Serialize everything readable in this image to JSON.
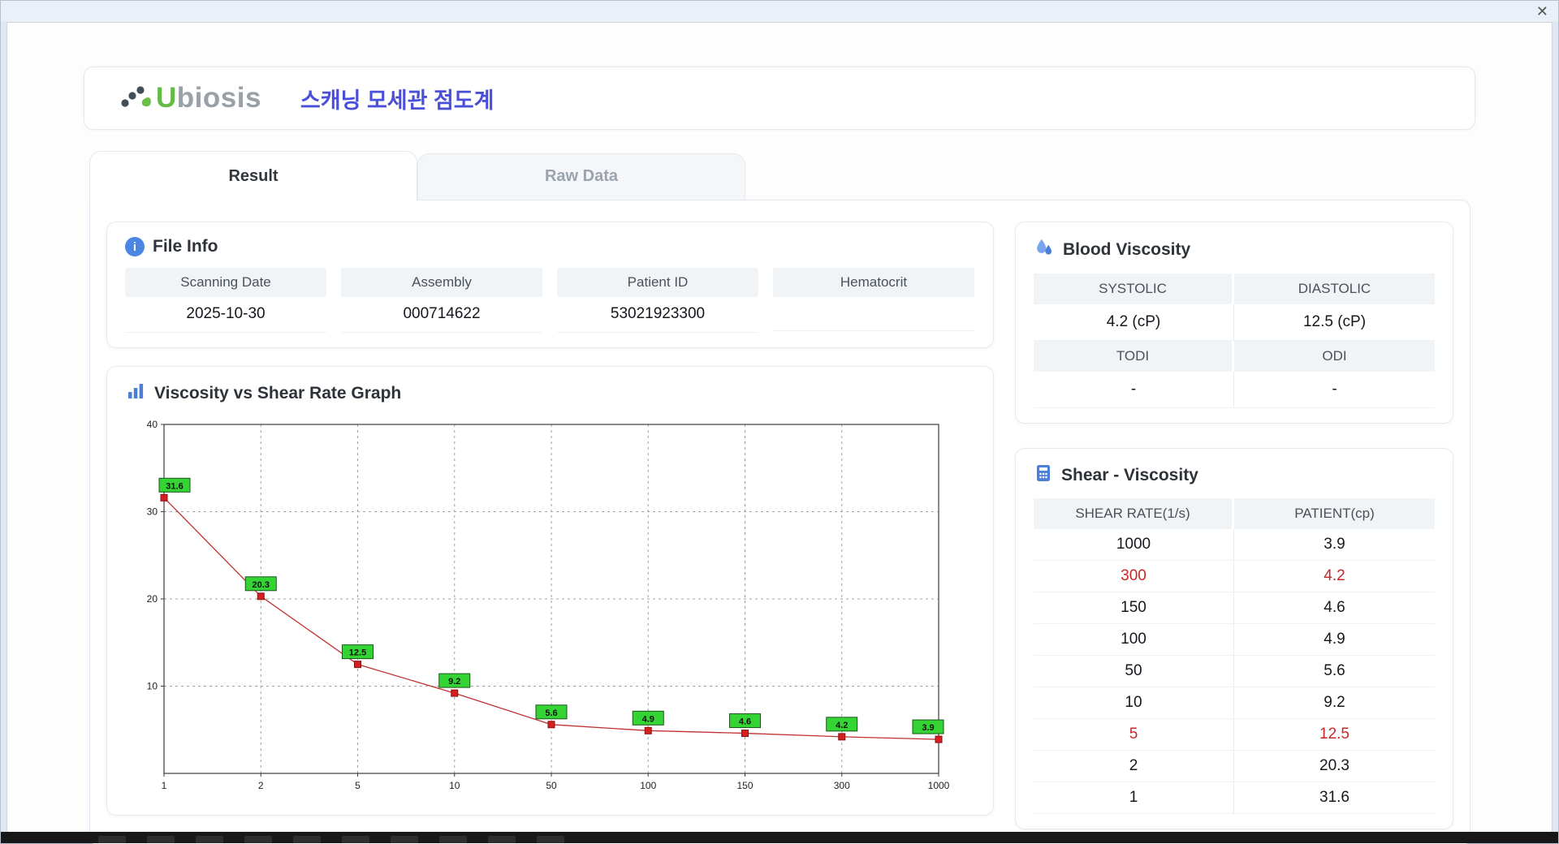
{
  "window": {
    "close_label": "✕"
  },
  "header": {
    "logo_u": "U",
    "logo_rest": "biosis",
    "app_title": "스캐닝 모세관 점도계"
  },
  "tabs": [
    {
      "label": "Result",
      "active": true
    },
    {
      "label": "Raw Data",
      "active": false
    }
  ],
  "file_info": {
    "title": "File Info",
    "info_icon_glyph": "i",
    "fields": [
      {
        "label": "Scanning Date",
        "value": "2025-10-30"
      },
      {
        "label": "Assembly",
        "value": "000714622"
      },
      {
        "label": "Patient ID",
        "value": "53021923300"
      },
      {
        "label": "Hematocrit",
        "value": ""
      }
    ]
  },
  "blood_viscosity": {
    "title": "Blood Viscosity",
    "metrics": [
      {
        "label": "SYSTOLIC",
        "value": "4.2 (cP)"
      },
      {
        "label": "DIASTOLIC",
        "value": "12.5 (cP)"
      },
      {
        "label": "TODI",
        "value": "-"
      },
      {
        "label": "ODI",
        "value": "-"
      }
    ]
  },
  "shear_viscosity": {
    "title": "Shear - Viscosity",
    "columns": [
      "SHEAR RATE(1/s)",
      "PATIENT(cp)"
    ],
    "rows": [
      {
        "shear_rate": "1000",
        "patient": "3.9",
        "highlight": false
      },
      {
        "shear_rate": "300",
        "patient": "4.2",
        "highlight": true
      },
      {
        "shear_rate": "150",
        "patient": "4.6",
        "highlight": false
      },
      {
        "shear_rate": "100",
        "patient": "4.9",
        "highlight": false
      },
      {
        "shear_rate": "50",
        "patient": "5.6",
        "highlight": false
      },
      {
        "shear_rate": "10",
        "patient": "9.2",
        "highlight": false
      },
      {
        "shear_rate": "5",
        "patient": "12.5",
        "highlight": true
      },
      {
        "shear_rate": "2",
        "patient": "20.3",
        "highlight": false
      },
      {
        "shear_rate": "1",
        "patient": "31.6",
        "highlight": false
      }
    ]
  },
  "graph": {
    "title": "Viscosity vs Shear Rate Graph"
  },
  "chart_data": {
    "type": "line",
    "title": "Viscosity vs Shear Rate Graph",
    "xlabel": "",
    "ylabel": "",
    "x_scale": "categorical",
    "x_categories": [
      "1",
      "2",
      "5",
      "10",
      "50",
      "100",
      "150",
      "300",
      "1000"
    ],
    "series": [
      {
        "name": "PATIENT(cp)",
        "values": [
          31.6,
          20.3,
          12.5,
          9.2,
          5.6,
          4.9,
          4.6,
          4.2,
          3.9
        ]
      }
    ],
    "point_labels": [
      "31.6",
      "20.3",
      "12.5",
      "9.2",
      "5.6",
      "4.9",
      "4.6",
      "4.2",
      "3.9"
    ],
    "ylim": [
      0,
      40
    ],
    "yticks": [
      10,
      20,
      30,
      40
    ],
    "grid": true,
    "line_color": "#c03030",
    "marker_color": "#d42020",
    "marker_stroke": "#8a1010",
    "label_bg": "#35d435",
    "label_stroke": "#1c541c"
  }
}
